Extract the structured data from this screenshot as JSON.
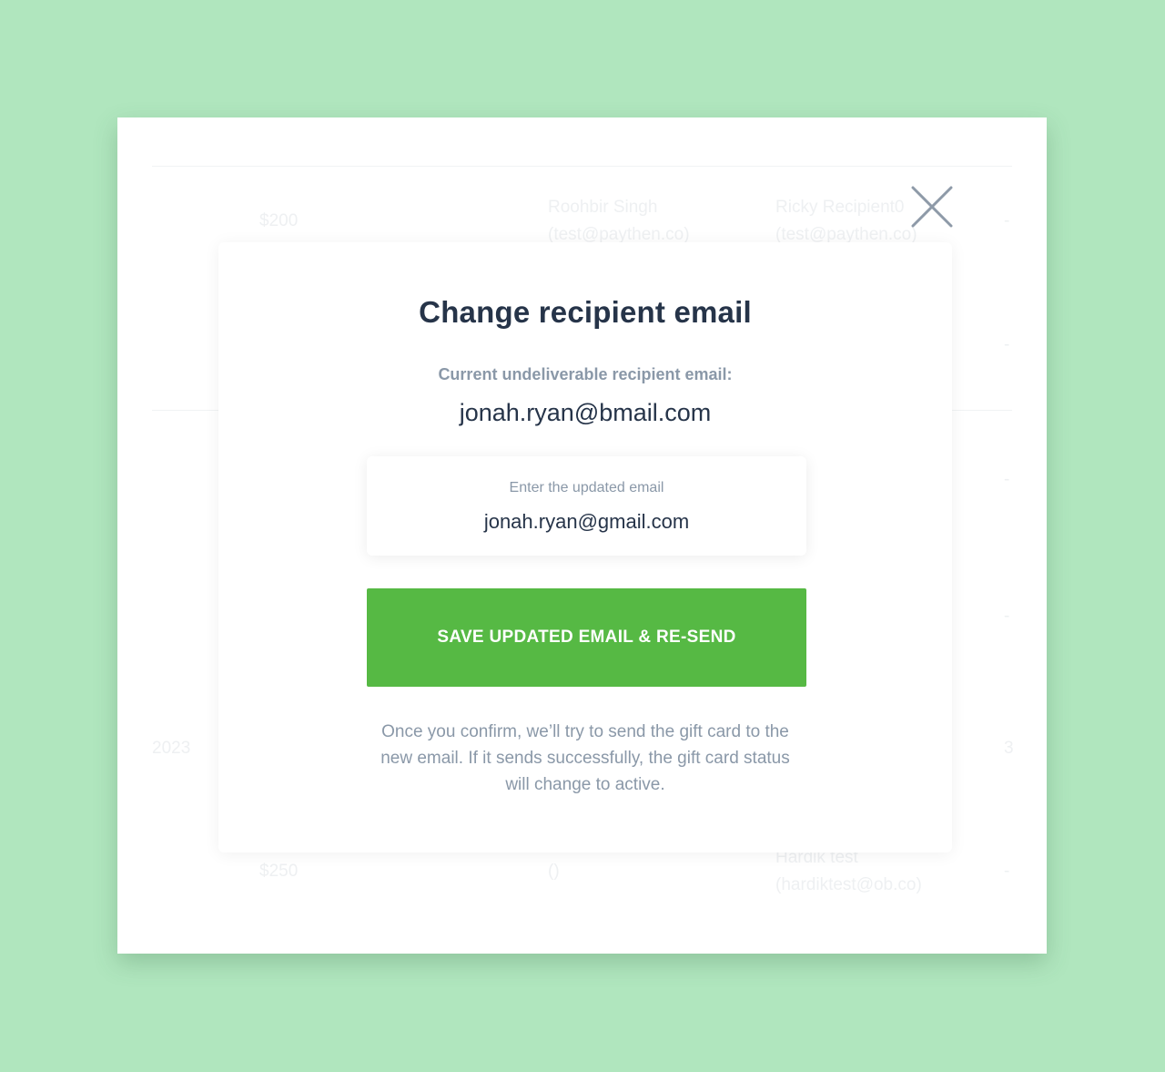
{
  "background_table": {
    "rows": [
      {
        "amount": "$200",
        "sender": "Roohbir Singh",
        "sender_email": "(test@paythen.co)",
        "recipient": "Ricky Recipient0",
        "recipient_email": "(test@paythen.co)",
        "trailing": "-"
      },
      {
        "amount": "$250",
        "sender": "()",
        "recipient": "Hardik test",
        "recipient_email": "(hardiktest@ob.co)",
        "trailing": "-"
      }
    ],
    "year_fragment": "2023",
    "number_fragment": "3",
    "dash": "-"
  },
  "modal": {
    "close_icon": "close-x-icon",
    "title": "Change recipient email",
    "current_label": "Current undeliverable recipient email:",
    "current_email": "jonah.ryan@bmail.com",
    "field": {
      "label": "Enter the updated email",
      "value": "jonah.ryan@gmail.com"
    },
    "save_button_label": "SAVE UPDATED EMAIL & RE-SEND",
    "note": "Once you confirm, we’ll try to send the gift card to the new email. If it sends successfully, the gift card status will change to active."
  },
  "colors": {
    "page_background": "#b0e6be",
    "primary_button": "#56b944",
    "title_text": "#263449",
    "muted_text": "#8a98a8"
  }
}
